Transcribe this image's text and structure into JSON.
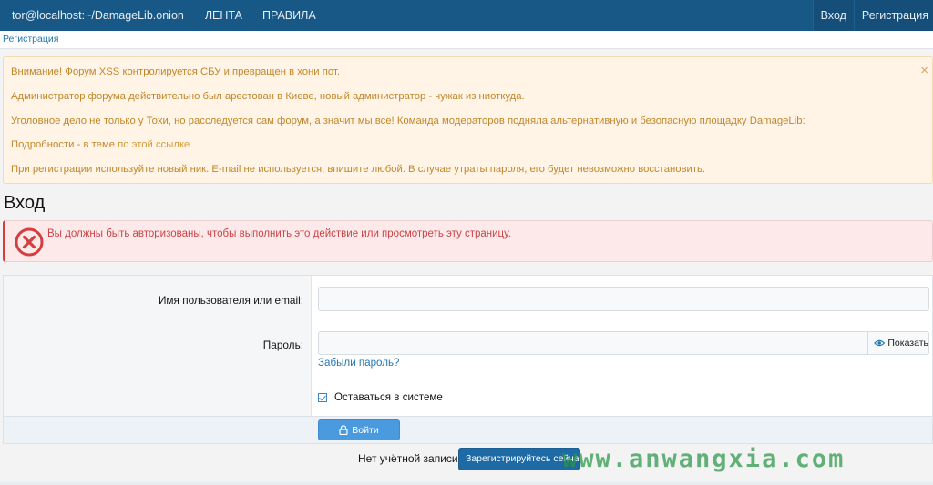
{
  "topbar": {
    "brand": "tor@localhost:~/DamageLib.onion",
    "nav": [
      "ЛЕНТА",
      "ПРАВИЛА"
    ],
    "login": "Вход",
    "register": "Регистрация"
  },
  "breadcrumb": "Регистрация",
  "notice": {
    "line1": "Внимание! Форум XSS контролируется СБУ и превращен в хони пот.",
    "line2": "Администратор форума действительно был арестован в Киеве, новый администратор - чужак из ниоткуда.",
    "line3": "Уголовное дело не только у Тохи, но расследуется сам форум, а значит мы все! Команда модераторов подняла альтернативную и безопасную площадку DamageLib:",
    "line4_prefix": "Подробности - в теме",
    "line4_link": "по этой ссылке",
    "line5": "При регистрации используйте новый ник. E-mail не используется, впишите любой. В случае утраты пароля, его будет невозможно восстановить.",
    "close": "×"
  },
  "page_title": "Вход",
  "error_message": "Вы должны быть авторизованы, чтобы выполнить это действие или просмотреть эту страницу.",
  "form": {
    "username_label": "Имя пользователя или email:",
    "username_value": "",
    "password_label": "Пароль:",
    "password_value": "",
    "show_label": "Показать",
    "forgot_label": "Забыли пароль?",
    "stay_label": "Оставаться в системе",
    "stay_checked": true,
    "submit_label": "Войти"
  },
  "register_prompt": "Нет учётной записи?",
  "register_button": "Зарегистрируйтесь сейчас",
  "watermark": "www.anwangxia.com",
  "colors": {
    "topbar": "#185886",
    "notice_text": "#c1872c",
    "error_text": "#c84448",
    "link": "#2577b1",
    "primary_button": "#4a9ae0",
    "register_button": "#1e6aa5"
  },
  "icons": [
    "error-circle-x-icon",
    "eye-icon",
    "lock-icon",
    "checkbox-checked-icon",
    "close-icon"
  ]
}
